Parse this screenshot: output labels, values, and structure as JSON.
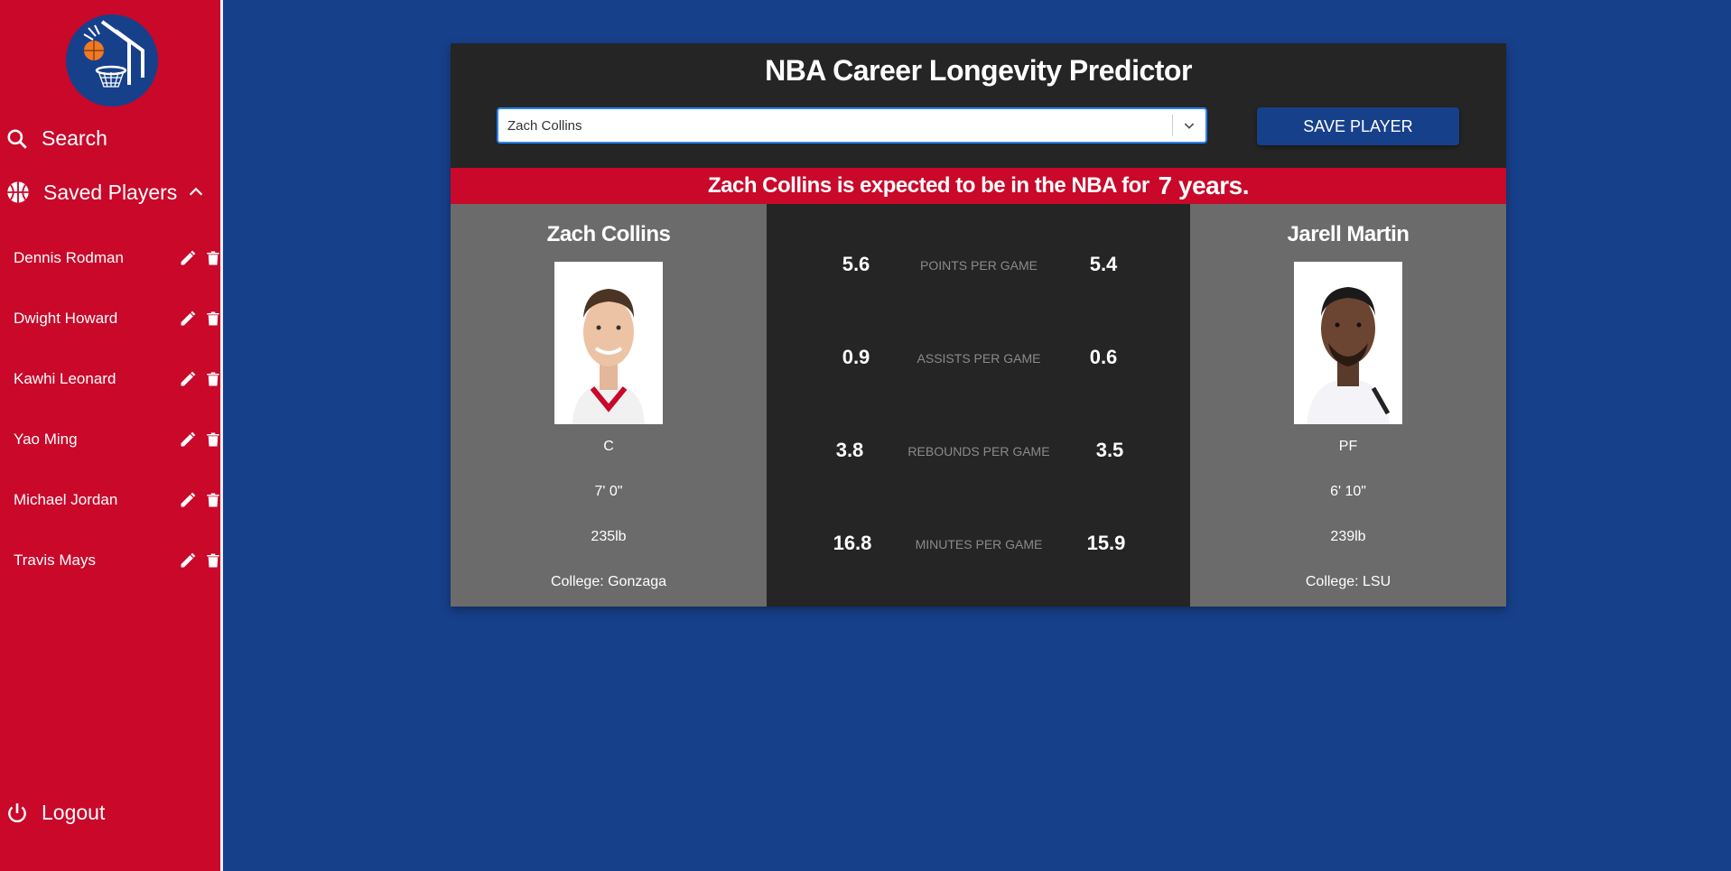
{
  "sidebar": {
    "search_label": "Search",
    "saved_label": "Saved Players",
    "logout_label": "Logout",
    "saved_players": [
      {
        "name": "Dennis Rodman"
      },
      {
        "name": "Dwight Howard"
      },
      {
        "name": "Kawhi Leonard"
      },
      {
        "name": "Yao Ming"
      },
      {
        "name": "Michael Jordan"
      },
      {
        "name": "Travis Mays"
      }
    ]
  },
  "main": {
    "title": "NBA Career Longevity Predictor",
    "select_value": "Zach Collins",
    "save_button": "SAVE PLAYER",
    "banner_prefix": "Zach Collins is expected to be in the NBA for",
    "banner_years": "7 years."
  },
  "player_left": {
    "name": "Zach Collins",
    "position": "C",
    "height": "7' 0\"",
    "weight": "235lb",
    "college": "College: Gonzaga"
  },
  "player_right": {
    "name": "Jarell Martin",
    "position": "PF",
    "height": "6' 10\"",
    "weight": "239lb",
    "college": "College: LSU"
  },
  "stats": [
    {
      "left": "5.6",
      "label": "POINTS PER GAME",
      "right": "5.4"
    },
    {
      "left": "0.9",
      "label": "ASSISTS PER GAME",
      "right": "0.6"
    },
    {
      "left": "3.8",
      "label": "REBOUNDS PER GAME",
      "right": "3.5"
    },
    {
      "left": "16.8",
      "label": "MINUTES PER GAME",
      "right": "15.9"
    }
  ],
  "colors": {
    "nba_red": "#c9082a",
    "nba_blue": "#17408b",
    "card_dark": "#252525",
    "player_gray": "#6b6b6b"
  }
}
